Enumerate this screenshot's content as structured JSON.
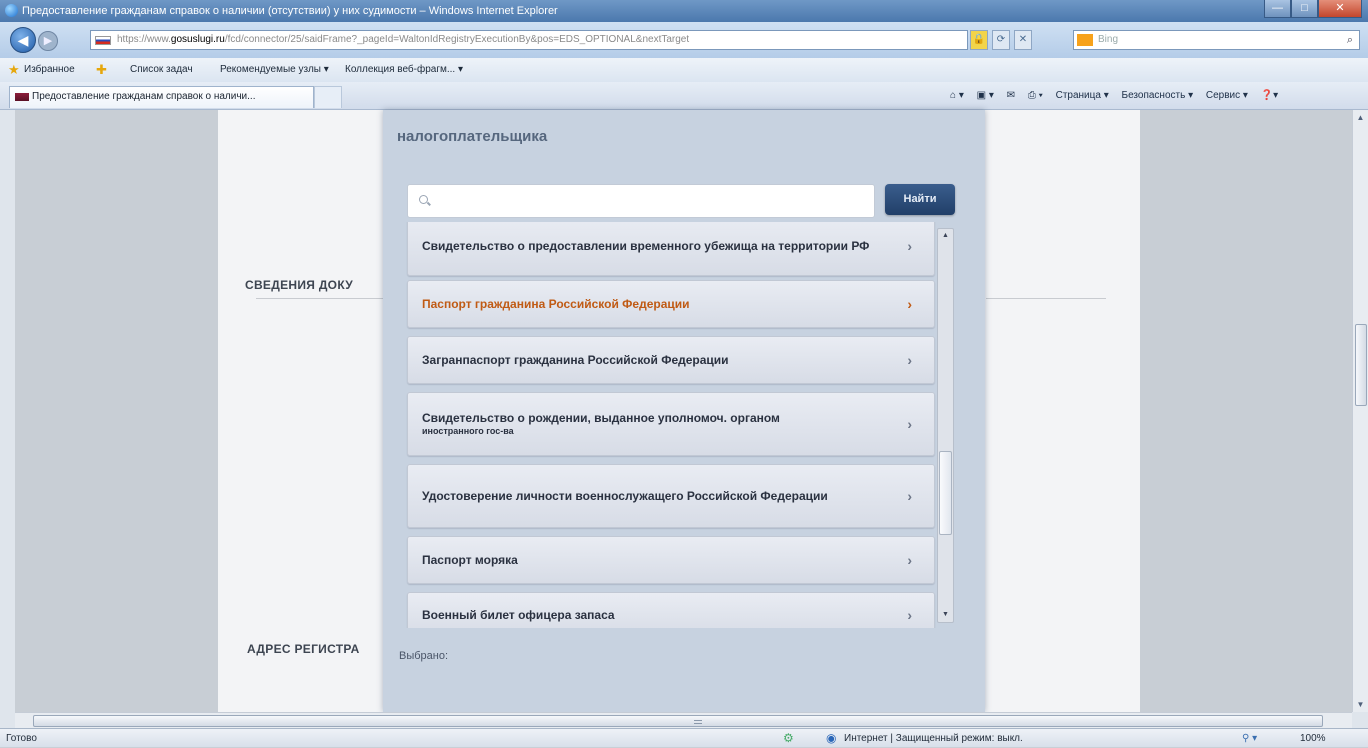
{
  "window": {
    "title": "Предоставление гражданам справок о наличии (отсутствии) у них судимости – Windows Internet Explorer",
    "controls": {
      "minimize": "—",
      "maximize": "□",
      "close": "✕"
    }
  },
  "address": {
    "url_host": "gosuslugi.ru",
    "url_scheme": "https://www.",
    "url_rest": "/fcd/connector/25/saidFrame?_pageId=WaltonIdRegistryExecutionBy&pos=EDS_OPTIONAL&nextTarget",
    "search_placeholder": "Bing",
    "lock_glyph": "🔒",
    "tool_glyphs": [
      "⟳",
      "✕"
    ]
  },
  "favorites": {
    "label": "Избранное",
    "items": [
      "Список задач",
      "Рекомендуемые узлы ▾",
      "Коллекция веб-фрагм... ▾"
    ]
  },
  "tab": {
    "title": "Предоставление гражданам справок о наличи..."
  },
  "command_bar": {
    "items": [
      "Страница ▾",
      "Безопасность ▾",
      "Сервис ▾",
      "❓▾"
    ]
  },
  "page": {
    "section_documents": "СВЕДЕНИЯ ДОКУ",
    "section_address": "АДРЕС РЕГИСТРА"
  },
  "modal": {
    "title": "налогоплательщика",
    "search_placeholder": "",
    "find_button": "Найти",
    "selected_label": "Выбрано:",
    "items": [
      {
        "title": "Свидетельство о предоставлении временного убежища на территории РФ",
        "sub": "",
        "active": false
      },
      {
        "title": "Паспорт гражданина Российской Федерации",
        "sub": "",
        "active": true
      },
      {
        "title": "Загранпаспорт гражданина Российской Федерации",
        "sub": "",
        "active": false
      },
      {
        "title": "Свидетельство о рождении, выданное уполномоч. органом",
        "sub": "иностранного гос-ва",
        "active": false
      },
      {
        "title": "Удостоверение личности военнослужащего Российской Федерации",
        "sub": "",
        "active": false
      },
      {
        "title": "Паспорт моряка",
        "sub": "",
        "active": false
      },
      {
        "title": "Военный билет офицера запаса",
        "sub": "",
        "active": false
      }
    ],
    "chevron": "›"
  },
  "status": {
    "left": "Готово",
    "zone": "Интернет | Защищенный режим: выкл.",
    "zoom": "100%"
  },
  "colors": {
    "active_item": "#c05a14",
    "find_button": "#2b4a78",
    "titlebar": "#5a85b8"
  }
}
